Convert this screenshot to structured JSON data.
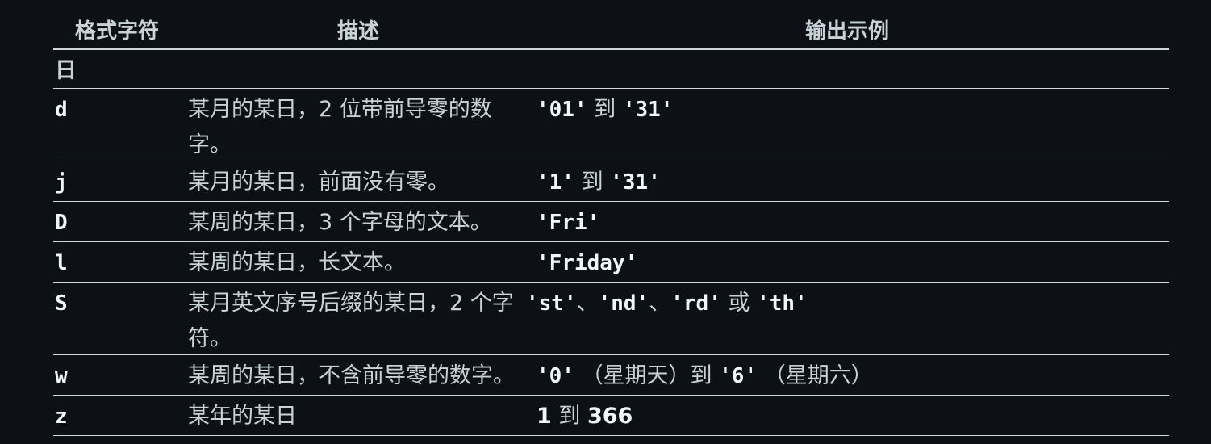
{
  "table": {
    "headers": [
      "格式字符",
      "描述",
      "输出示例"
    ],
    "group": "日",
    "rows": [
      {
        "fmt": "d",
        "desc": "某月的某日，2 位带前导零的数字。",
        "out": [
          "'01'",
          "到",
          "'31'"
        ]
      },
      {
        "fmt": "j",
        "desc": "某月的某日，前面没有零。",
        "out": [
          "'1'",
          "到",
          "'31'"
        ]
      },
      {
        "fmt": "D",
        "desc": "某周的某日，3 个字母的文本。",
        "out": [
          "'Fri'"
        ]
      },
      {
        "fmt": "l",
        "desc": "某周的某日，长文本。",
        "out": [
          "'Friday'"
        ]
      },
      {
        "fmt": "S",
        "desc": "某月英文序号后缀的某日，2 个字符。",
        "out": [
          "'st'",
          "、",
          "'nd'",
          "、",
          "'rd'",
          "或",
          "'th'"
        ]
      },
      {
        "fmt": "w",
        "desc": "某周的某日，不含前导零的数字。",
        "out": [
          "'0'",
          "（星期天）到",
          "'6'",
          "（星期六）"
        ]
      },
      {
        "fmt": "z",
        "desc": "某年的某日",
        "out": [
          "1",
          "到",
          "366"
        ]
      }
    ]
  },
  "colors": {
    "background": "#0d1117",
    "text": "#c9d1d9",
    "code": "#f0f6fc",
    "rule": "#d0d7de"
  }
}
